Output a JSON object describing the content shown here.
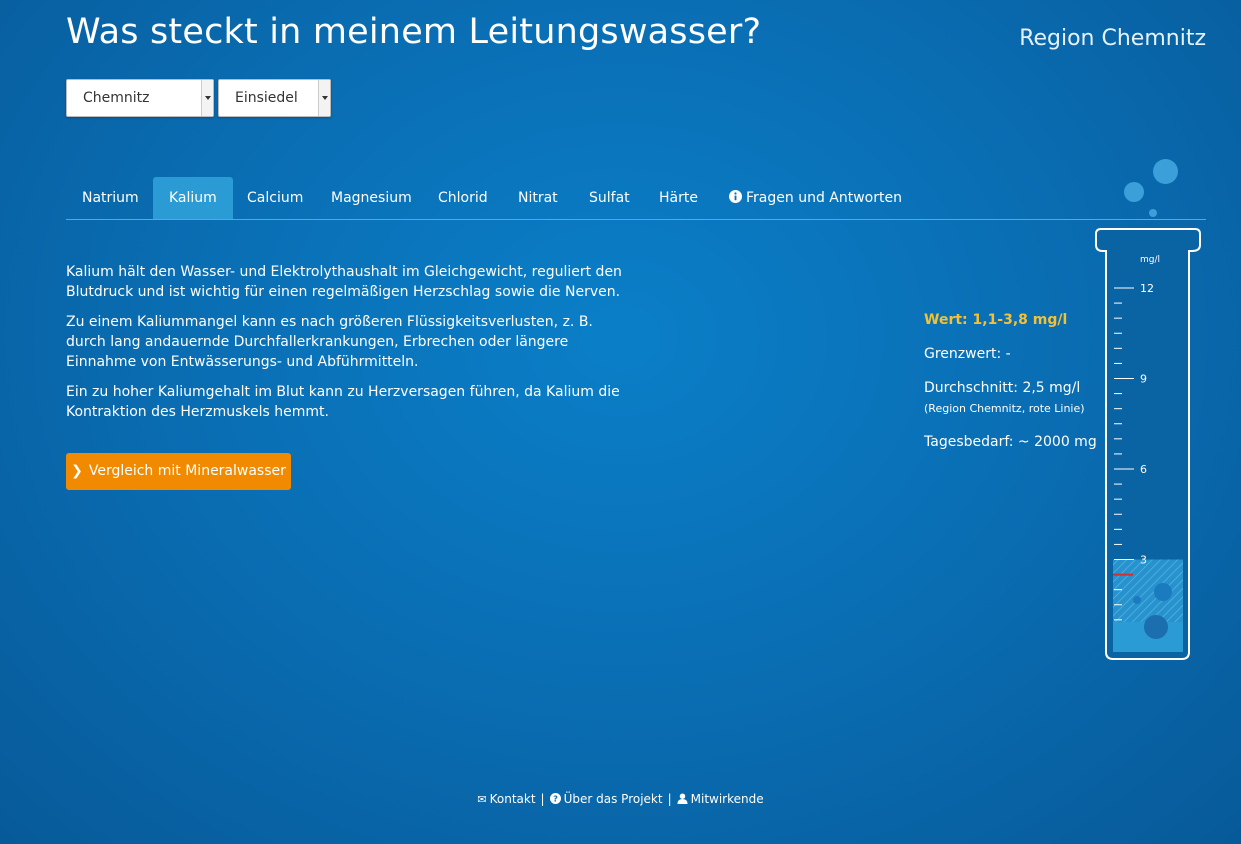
{
  "header": {
    "title": "Was steckt in meinem Leitungswasser?",
    "region": "Region Chemnitz"
  },
  "selects": {
    "city": "Chemnitz",
    "district": "Einsiedel"
  },
  "tabs": [
    {
      "label": "Natrium"
    },
    {
      "label": "Kalium"
    },
    {
      "label": "Calcium"
    },
    {
      "label": "Magnesium"
    },
    {
      "label": "Chlorid"
    },
    {
      "label": "Nitrat"
    },
    {
      "label": "Sulfat"
    },
    {
      "label": "Härte"
    },
    {
      "label": "Fragen und Antworten"
    }
  ],
  "active_tab": "Kalium",
  "description": {
    "p1": "Kalium hält den Wasser- und Elektrolythaushalt im Gleichgewicht, reguliert den Blutdruck und ist wichtig für einen regelmäßigen Herzschlag sowie die Nerven.",
    "p2": "Zu einem Kaliummangel kann es nach größeren Flüssigkeitsverlusten, z. B. durch lang andauernde Durchfallerkrankungen, Erbrechen oder längere Einnahme von Entwässerungs- und Abführmitteln.",
    "p3": "Ein zu hoher Kaliumgehalt im Blut kann zu Herzversagen führen, da Kalium die Kontraktion des Herzmuskels hemmt."
  },
  "compare_button": "Vergleich mit Mineralwasser",
  "stats": {
    "wert": "Wert: 1,1-3,8 mg/l",
    "grenzwert": "Grenzwert: -",
    "durchschnitt": "Durchschnitt: 2,5 mg/l",
    "durchschnitt_note": "(Region Chemnitz, rote Linie)",
    "tagesbedarf": "Tagesbedarf: ~ 2000 mg"
  },
  "tube": {
    "unit": "mg/l",
    "major_ticks": [
      "12",
      "9",
      "6",
      "3"
    ],
    "scale_max": 13.5,
    "fill_level_mgl": 3.0,
    "average_line_mgl": 2.5,
    "colors": {
      "water": "#2b9bd6",
      "average_line": "#d0302f",
      "outline": "#ffffff"
    }
  },
  "footer": {
    "kontakt": "Kontakt",
    "projekt": "Über das Projekt",
    "mitwirkende": "Mitwirkende",
    "separator": "|"
  },
  "colors": {
    "background": "#0a6fb5",
    "active_tab": "#2b9bd6",
    "accent_orange": "#f28a00",
    "wert_yellow": "#f6c033"
  }
}
